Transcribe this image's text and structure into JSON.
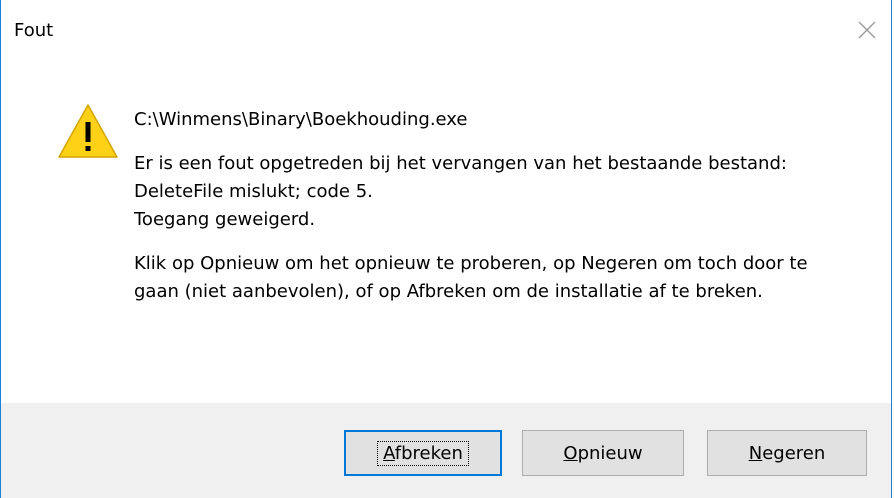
{
  "window": {
    "title": "Fout"
  },
  "message": {
    "path": "C:\\Winmens\\Binary\\Boekhouding.exe",
    "error_line1": "Er is een fout opgetreden bij het vervangen van het bestaande bestand:",
    "error_line2": "DeleteFile mislukt; code 5.",
    "error_line3": "Toegang geweigerd.",
    "instruction": "Klik op Opnieuw om het opnieuw te proberen, op Negeren om toch door te gaan (niet aanbevolen), of op Afbreken om de installatie af te breken."
  },
  "buttons": {
    "abort": {
      "mnemonic": "A",
      "rest": "fbreken"
    },
    "retry": {
      "mnemonic": "O",
      "rest": "pnieuw"
    },
    "ignore": {
      "mnemonic": "N",
      "rest": "egeren"
    }
  },
  "icons": {
    "warning": "warning-icon",
    "close": "close-icon"
  },
  "colors": {
    "accent": "#0078d7",
    "window_border": "#1f7fd6",
    "warning_fill": "#fcd116",
    "footer_bg": "#f0f0f0"
  }
}
